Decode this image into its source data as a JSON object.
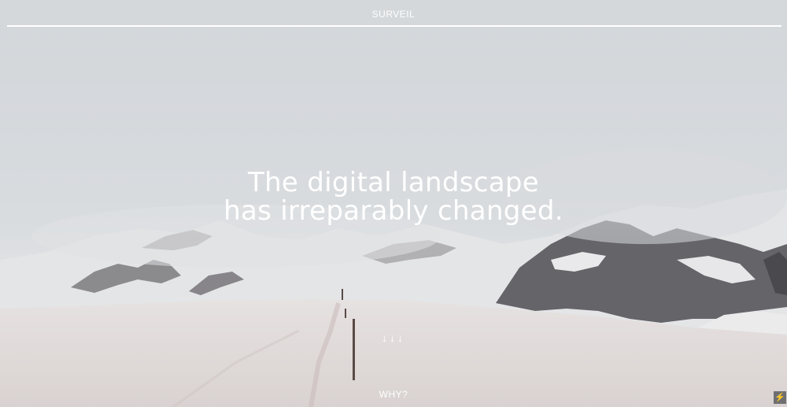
{
  "header": {
    "brand": "SURVEIL"
  },
  "hero": {
    "line1": "The digital landscape",
    "line2": "has irreparably changed."
  },
  "scroll": {
    "arrows": "↓↓↓"
  },
  "footer": {
    "why_link": "WHY?",
    "bolt_icon": "⚡"
  },
  "colors": {
    "text": "#ffffff",
    "badge": "#6f6f72"
  },
  "icons": [
    "down-arrow-icon",
    "lightning-bolt-icon"
  ]
}
